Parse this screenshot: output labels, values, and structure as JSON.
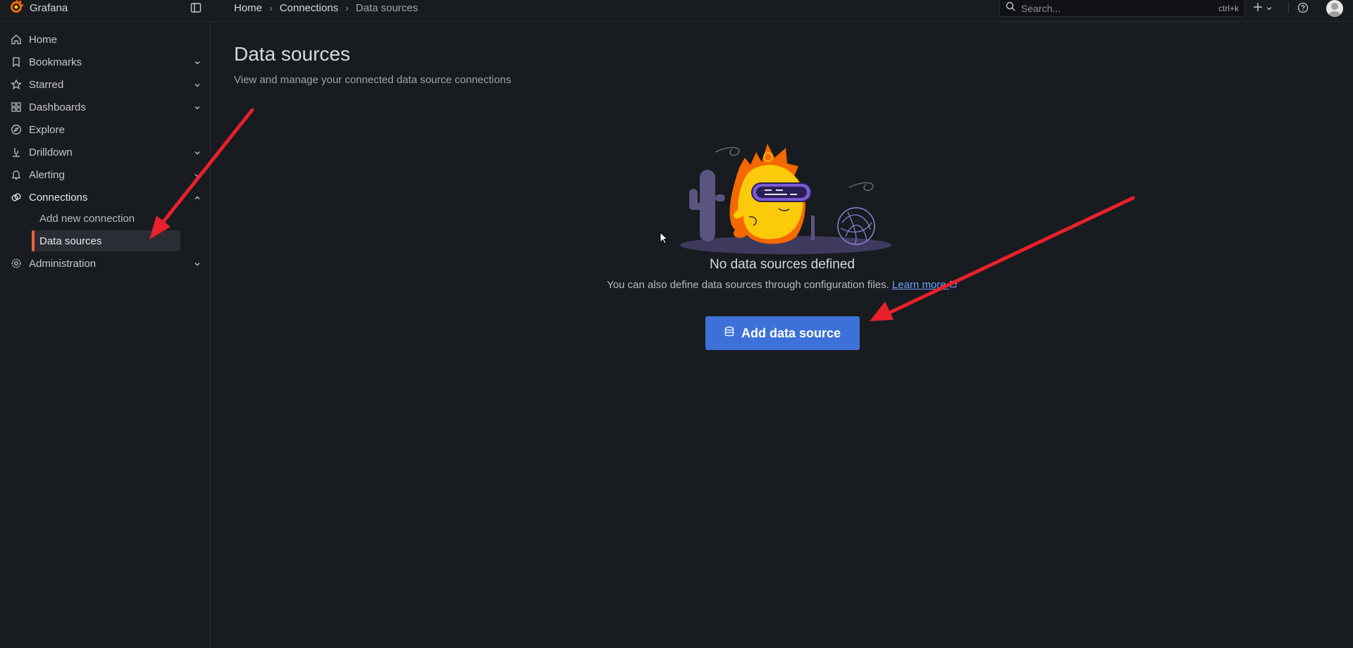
{
  "app": {
    "name": "Grafana"
  },
  "breadcrumb": [
    "Home",
    "Connections",
    "Data sources"
  ],
  "search": {
    "placeholder": "Search...",
    "shortcut": "ctrl+k"
  },
  "sidebar": {
    "items": [
      {
        "label": "Home",
        "icon": "home-icon",
        "has_chevron": false
      },
      {
        "label": "Bookmarks",
        "icon": "bookmark-icon",
        "has_chevron": true
      },
      {
        "label": "Starred",
        "icon": "star-icon",
        "has_chevron": true
      },
      {
        "label": "Dashboards",
        "icon": "dashboards-icon",
        "has_chevron": true
      },
      {
        "label": "Explore",
        "icon": "compass-icon",
        "has_chevron": false
      },
      {
        "label": "Drilldown",
        "icon": "drilldown-icon",
        "has_chevron": true
      },
      {
        "label": "Alerting",
        "icon": "bell-icon",
        "has_chevron": true
      },
      {
        "label": "Connections",
        "icon": "connections-icon",
        "has_chevron": true,
        "expanded": true
      },
      {
        "label": "Administration",
        "icon": "gear-icon",
        "has_chevron": true
      }
    ],
    "connections_children": [
      {
        "label": "Add new connection",
        "active": false
      },
      {
        "label": "Data sources",
        "active": true
      }
    ]
  },
  "page": {
    "title": "Data sources",
    "subtitle": "View and manage your connected data source connections"
  },
  "empty_state": {
    "title": "No data sources defined",
    "text": "You can also define data sources through configuration files.",
    "link_label": "Learn more",
    "button_label": "Add data source",
    "button_icon": "database-icon"
  },
  "colors": {
    "accent": "#f55f3e",
    "primary_button": "#3d71d9",
    "link": "#6e9fff",
    "annotation_arrow": "#e8212b"
  }
}
